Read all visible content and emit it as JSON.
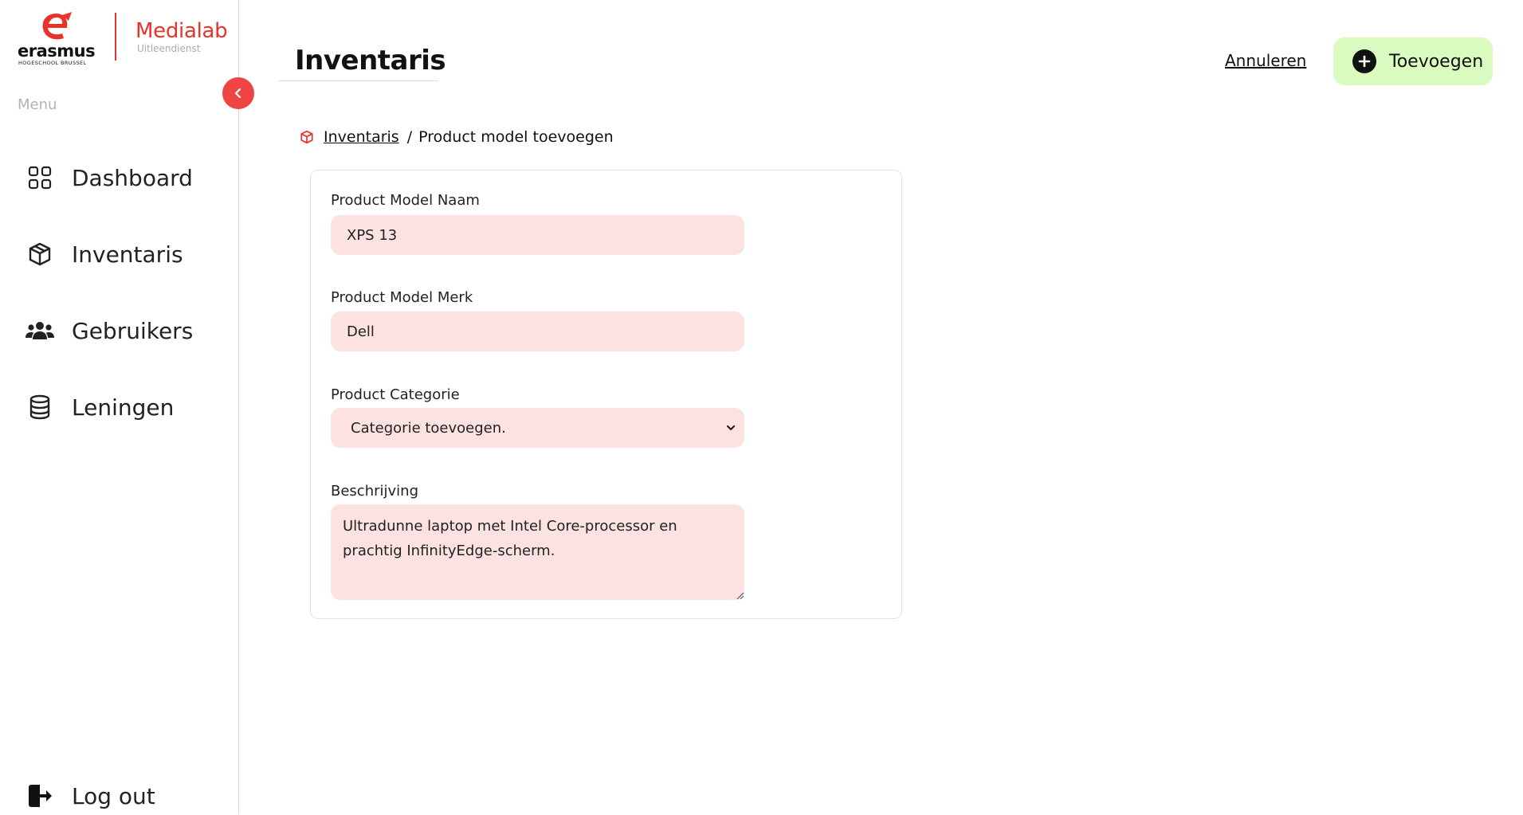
{
  "brand": {
    "name": "erasmus",
    "subtitle": "HOGESCHOOL  BRUSSEL",
    "app_name": "Medialab",
    "app_sub": "Uitleendienst",
    "accent": "#e8332d"
  },
  "sidebar": {
    "menu_label": "Menu",
    "items": [
      {
        "label": "Dashboard",
        "icon": "grid-icon"
      },
      {
        "label": "Inventaris",
        "icon": "box-icon"
      },
      {
        "label": "Gebruikers",
        "icon": "users-icon"
      },
      {
        "label": "Leningen",
        "icon": "database-icon"
      }
    ],
    "logout_label": "Log out"
  },
  "header": {
    "title": "Inventaris",
    "cancel_label": "Annuleren",
    "add_label": "Toevoegen",
    "add_color": "#d9fbbf"
  },
  "breadcrumb": {
    "link": "Inventaris",
    "separator": "/",
    "current": "Product model toevoegen"
  },
  "form": {
    "name_label": "Product Model Naam",
    "name_value": "XPS 13",
    "brand_label": "Product Model Merk",
    "brand_value": "Dell",
    "category_label": "Product Categorie",
    "category_value": "Categorie toevoegen.",
    "description_label": "Beschrijving",
    "description_value": "Ultradunne laptop met Intel Core-processor en prachtig InfinityEdge-scherm.",
    "field_color": "#fde2e2"
  }
}
